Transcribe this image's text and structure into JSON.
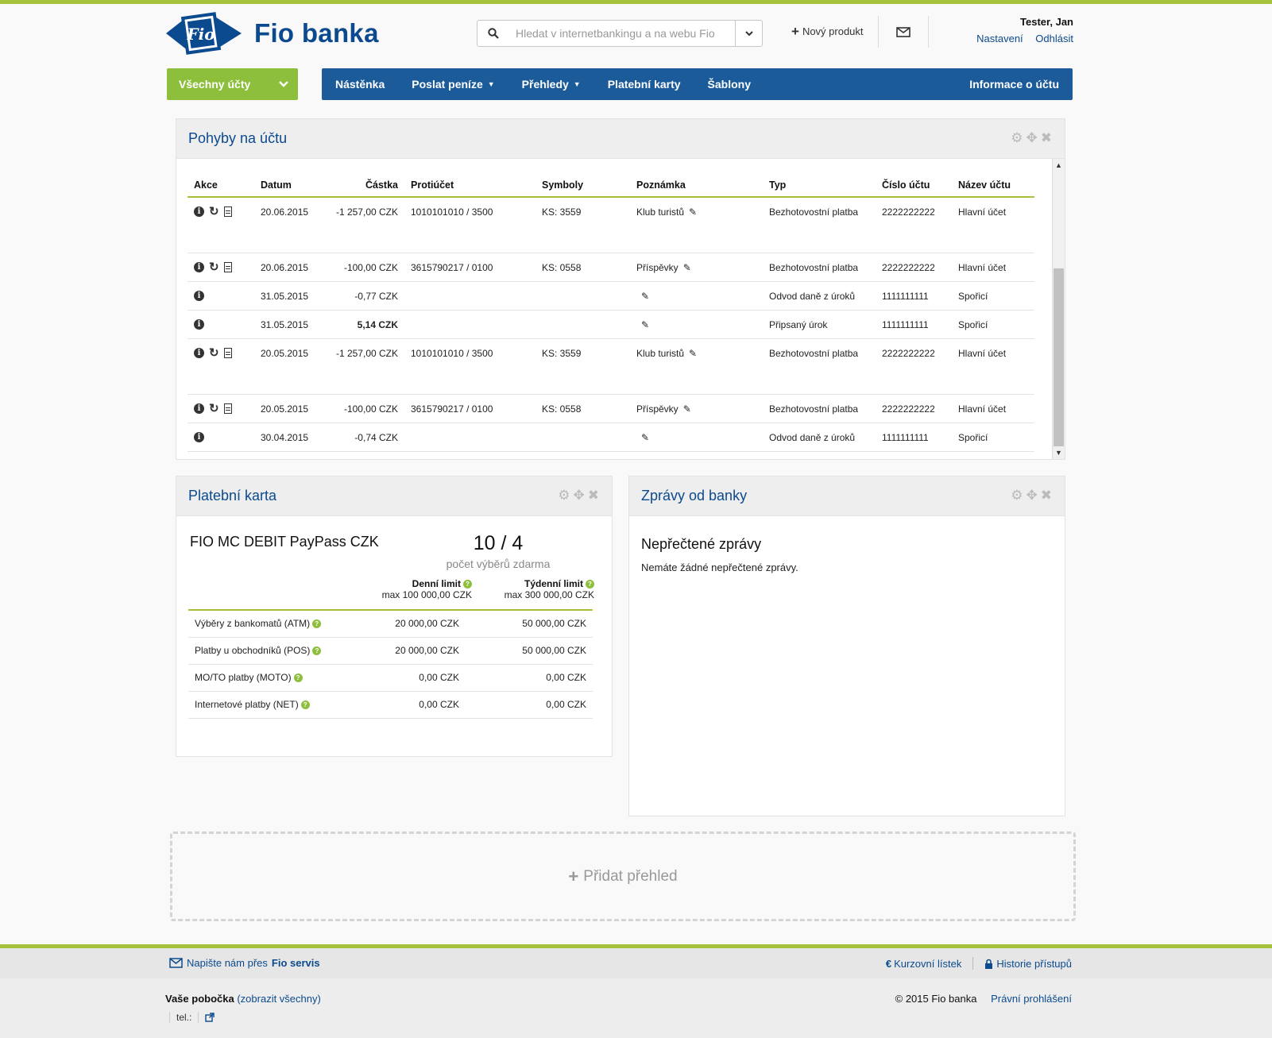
{
  "header": {
    "brand": "Fio banka",
    "logo_text": "Fio",
    "search_placeholder": "Hledat v internetbankingu a na webu Fio",
    "new_product": "Nový produkt",
    "user_name": "Tester, Jan",
    "settings": "Nastavení",
    "logout": "Odhlásit"
  },
  "nav": {
    "account_select": "Všechny účty",
    "items": [
      "Nástěnka",
      "Poslat peníze",
      "Přehledy",
      "Platební karty",
      "Šablony"
    ],
    "right_item": "Informace o účtu"
  },
  "transactions": {
    "title": "Pohyby na účtu",
    "columns": [
      "Akce",
      "Datum",
      "Částka",
      "Protiúčet",
      "Symboly",
      "Poznámka",
      "Typ",
      "Číslo účtu",
      "Název účtu"
    ],
    "rows": [
      {
        "date": "20.06.2015",
        "amount": "-1 257,00 CZK",
        "counter": "1010101010 / 3500",
        "symbols": "KS: 3559",
        "note": "Klub turistů",
        "type": "Bezhotovostní platba",
        "account": "2222222222",
        "account_name": "Hlavní účet"
      },
      {
        "date": "20.06.2015",
        "amount": "-100,00 CZK",
        "counter": "3615790217 / 0100",
        "symbols": "KS: 0558",
        "note": "Příspěvky",
        "type": "Bezhotovostní platba",
        "account": "2222222222",
        "account_name": "Hlavní účet"
      },
      {
        "date": "31.05.2015",
        "amount": "-0,77 CZK",
        "counter": "",
        "symbols": "",
        "note": "",
        "type": "Odvod daně z úroků",
        "account": "1111111111",
        "account_name": "Spořicí"
      },
      {
        "date": "31.05.2015",
        "amount": "5,14 CZK",
        "counter": "",
        "symbols": "",
        "note": "",
        "type": "Připsaný úrok",
        "account": "1111111111",
        "account_name": "Spořicí"
      },
      {
        "date": "20.05.2015",
        "amount": "-1 257,00 CZK",
        "counter": "1010101010 / 3500",
        "symbols": "KS: 3559",
        "note": "Klub turistů",
        "type": "Bezhotovostní platba",
        "account": "2222222222",
        "account_name": "Hlavní účet"
      },
      {
        "date": "20.05.2015",
        "amount": "-100,00 CZK",
        "counter": "3615790217 / 0100",
        "symbols": "KS: 0558",
        "note": "Příspěvky",
        "type": "Bezhotovostní platba",
        "account": "2222222222",
        "account_name": "Hlavní účet"
      },
      {
        "date": "30.04.2015",
        "amount": "-0,74 CZK",
        "counter": "",
        "symbols": "",
        "note": "",
        "type": "Odvod daně z úroků",
        "account": "1111111111",
        "account_name": "Spořicí"
      }
    ]
  },
  "card": {
    "title": "Platební karta",
    "name": "FIO MC DEBIT PayPass CZK",
    "count": "10 / 4",
    "count_label": "počet výběrů zdarma",
    "daily_label": "Denní limit",
    "daily_max": "max 100 000,00 CZK",
    "weekly_label": "Týdenní limit",
    "weekly_max": "max 300 000,00 CZK",
    "limits": [
      {
        "label": "Výběry z bankomatů (ATM)",
        "daily": "20 000,00 CZK",
        "weekly": "50 000,00 CZK"
      },
      {
        "label": "Platby u obchodníků (POS)",
        "daily": "20 000,00 CZK",
        "weekly": "50 000,00 CZK"
      },
      {
        "label": "MO/TO platby (MOTO)",
        "daily": "0,00 CZK",
        "weekly": "0,00 CZK"
      },
      {
        "label": "Internetové platby (NET)",
        "daily": "0,00 CZK",
        "weekly": "0,00 CZK"
      }
    ]
  },
  "messages": {
    "title": "Zprávy od banky",
    "heading": "Nepřečtené zprávy",
    "text": "Nemáte žádné nepřečtené zprávy."
  },
  "add_view": "Přidat přehled",
  "footer": {
    "write_prefix": "Napište nám přes",
    "write_link": "Fio servis",
    "rates": "Kurzovní lístek",
    "history": "Historie přístupů",
    "branch_label": "Vaše pobočka",
    "branch_link": "(zobrazit všechny)",
    "tel": "tel.:",
    "copyright": "© 2015 Fio banka",
    "legal": "Právní prohlášení"
  },
  "colors": {
    "brand_blue": "#0b4a8e",
    "nav_blue": "#1b5b9a",
    "accent_green": "#8dbf3c",
    "negative_red": "#d0352f"
  }
}
